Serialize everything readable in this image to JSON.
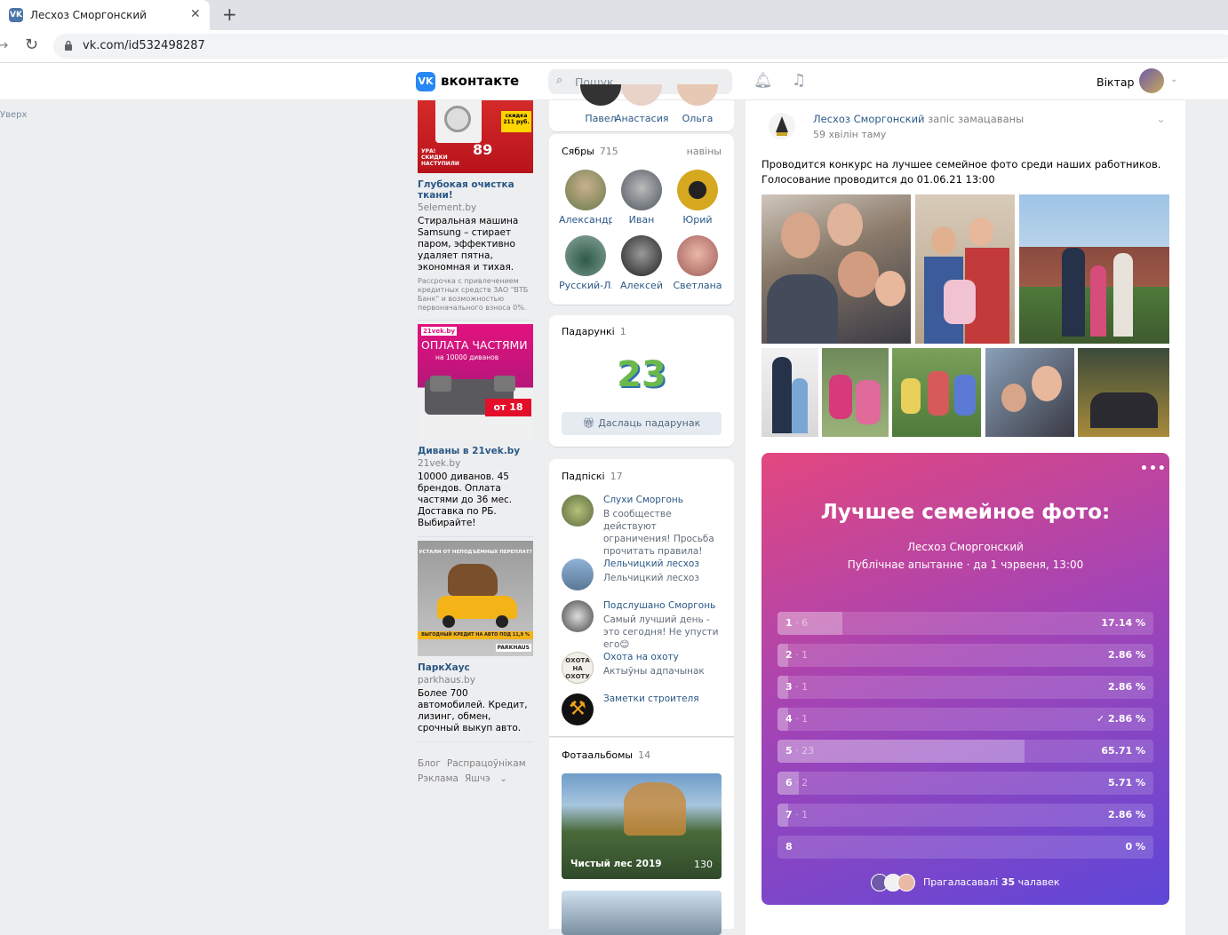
{
  "browser": {
    "tab_title": "Лесхоз Сморгонский",
    "url": "vk.com/id532498287"
  },
  "vk": {
    "logo": "вконтакте",
    "search_placeholder": "Пошук",
    "user_name": "Віктар"
  },
  "left": {
    "scroll_top": "Уверх",
    "ads": [
      {
        "img_big": "89",
        "img_small": "скидка 211 руб.",
        "img_caption": "УРА! СКИДКИ НАСТУПИЛИ",
        "title": "Глубокая очистка ткани!",
        "domain": "5element.by",
        "text": "Стиральная машина Samsung – стирает паром, эффективно удаляет пятна, экономная и тихая.",
        "fine": "Рассрочка с привлечением кредитных средств ЗАО \"ВТБ Банк\" и возможностью первоначального взноса 0%."
      },
      {
        "img_big": "ОПЛАТА ЧАСТЯМИ",
        "img_small": "на 10000 диванов",
        "img_caption": "от 18",
        "title": "Диваны в 21vek.by",
        "domain": "21vek.by",
        "text": "10000 диванов. 45 брендов. Оплата частями до 36 мес. Доставка по РБ. Выбирайте!"
      },
      {
        "img_big": "",
        "img_small": "УСТАЛИ ОТ НЕПОДЪЁМНЫХ ПЕРЕПЛАТ?",
        "img_caption": "ВЫГОДНЫЙ КРЕДИТ НА АВТО ПОД 11,9 %",
        "img_brand": "PARKHAUS",
        "title": "ПаркХаус",
        "domain": "parkhaus.by",
        "text": "Более 700 автомобилей. Кредит, лизинг, обмен, срочный выкуп авто."
      }
    ],
    "footer": [
      "Блог",
      "Распрацоўнікам",
      "Рэклама",
      "Яшчэ"
    ]
  },
  "middle": {
    "top_names": [
      "Павел",
      "Анастасия",
      "Ольга"
    ],
    "friends": {
      "title": "Сябры",
      "count": "715",
      "action": "навіны",
      "items": [
        {
          "name": "Александр",
          "color": "#6a7b4a"
        },
        {
          "name": "Иван",
          "color": "#4d5560"
        },
        {
          "name": "Юрий",
          "color": "#d6a820"
        },
        {
          "name": "Русский-Л...",
          "color": "#3c6e58"
        },
        {
          "name": "Алексей",
          "color": "#3a3a3a"
        },
        {
          "name": "Светлана",
          "color": "#a05a5a"
        }
      ]
    },
    "gifts": {
      "title": "Падарункі",
      "count": "1",
      "gift_text": "23",
      "button": "Даслаць падарунак"
    },
    "subs": {
      "title": "Падпіскі",
      "count": "17",
      "items": [
        {
          "name": "Слухи Сморгонь",
          "desc": "В сообществе действуют ограничения! Просьба прочитать правила!",
          "color": "#5b6a3e"
        },
        {
          "name": "Лельчицкий лесхоз",
          "desc": "Лельчицкий лесхоз",
          "color": "#5a7896"
        },
        {
          "name": "Подслушано Сморгонь",
          "desc": "Самый лучший день - это сегодня! Не упусти его😊",
          "color": "#444"
        },
        {
          "name": "Охота на охоту",
          "desc": "Актыўны адпачынак",
          "color": "#c9c4b8"
        },
        {
          "name": "Заметки строителя",
          "desc": "",
          "color": "#111"
        }
      ]
    },
    "albums": {
      "title": "Фотаальбомы",
      "count": "14",
      "album_name": "Чистый лес 2019",
      "album_count": "130"
    }
  },
  "post": {
    "author": "Лесхоз Сморгонский",
    "action": "запіс замацаваны",
    "time": "59 хвілін таму",
    "text_line1": "Проводится конкурс на лучшее семейное фото среди наших работников.",
    "text_line2": "Голосование проводится до 01.06.21 13:00"
  },
  "poll": {
    "title": "Лучшее семейное фото:",
    "owner": "Лесхоз Сморгонский",
    "meta": "Публічнае апытанне · да 1 чэрвеня, 13:00",
    "options": [
      {
        "label": "1",
        "votes": "6",
        "percent": "17.14 %",
        "share": 0.1714
      },
      {
        "label": "2",
        "votes": "1",
        "percent": "2.86 %",
        "share": 0.0286
      },
      {
        "label": "3",
        "votes": "1",
        "percent": "2.86 %",
        "share": 0.0286
      },
      {
        "label": "4",
        "votes": "1",
        "percent": "2.86 %",
        "share": 0.0286,
        "checked": true
      },
      {
        "label": "5",
        "votes": "23",
        "percent": "65.71 %",
        "share": 0.6571
      },
      {
        "label": "6",
        "votes": "2",
        "percent": "5.71 %",
        "share": 0.0571
      },
      {
        "label": "7",
        "votes": "1",
        "percent": "2.86 %",
        "share": 0.0286
      },
      {
        "label": "8",
        "votes": "",
        "percent": "0 %",
        "share": 0
      }
    ],
    "voted_prefix": "Прагаласавалі",
    "voted_count": "35",
    "voted_suffix": "чалавек"
  }
}
